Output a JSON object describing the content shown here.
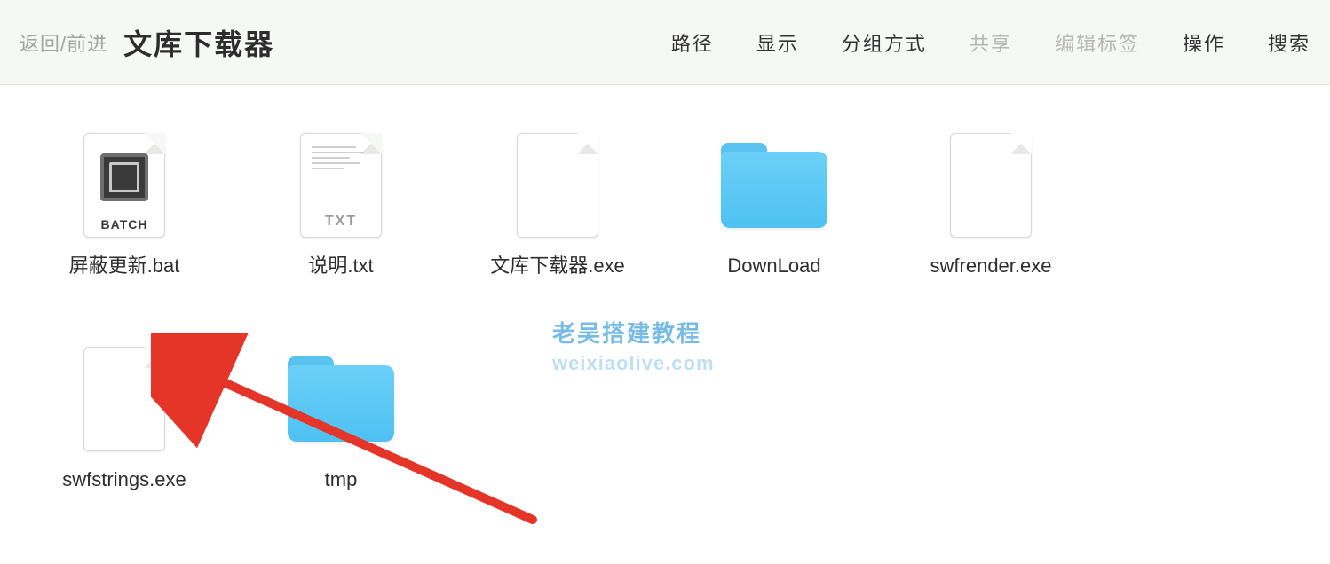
{
  "toolbar": {
    "nav_back_forward": "返回/前进",
    "title": "文库下载器",
    "items": [
      {
        "label": "路径",
        "disabled": false
      },
      {
        "label": "显示",
        "disabled": false
      },
      {
        "label": "分组方式",
        "disabled": false
      },
      {
        "label": "共享",
        "disabled": true
      },
      {
        "label": "编辑标签",
        "disabled": true
      },
      {
        "label": "操作",
        "disabled": false
      },
      {
        "label": "搜索",
        "disabled": false
      }
    ]
  },
  "files": [
    {
      "name": "屏蔽更新.bat",
      "type": "batch",
      "badge": "BATCH"
    },
    {
      "name": "说明.txt",
      "type": "txt",
      "badge": "TXT"
    },
    {
      "name": "文库下载器.exe",
      "type": "blank"
    },
    {
      "name": "DownLoad",
      "type": "folder"
    },
    {
      "name": "swfrender.exe",
      "type": "blank"
    },
    {
      "name": "swfstrings.exe",
      "type": "blank"
    },
    {
      "name": "tmp",
      "type": "folder"
    }
  ],
  "watermark": {
    "line1": "老吴搭建教程",
    "line2": "weixiaolive.com"
  }
}
